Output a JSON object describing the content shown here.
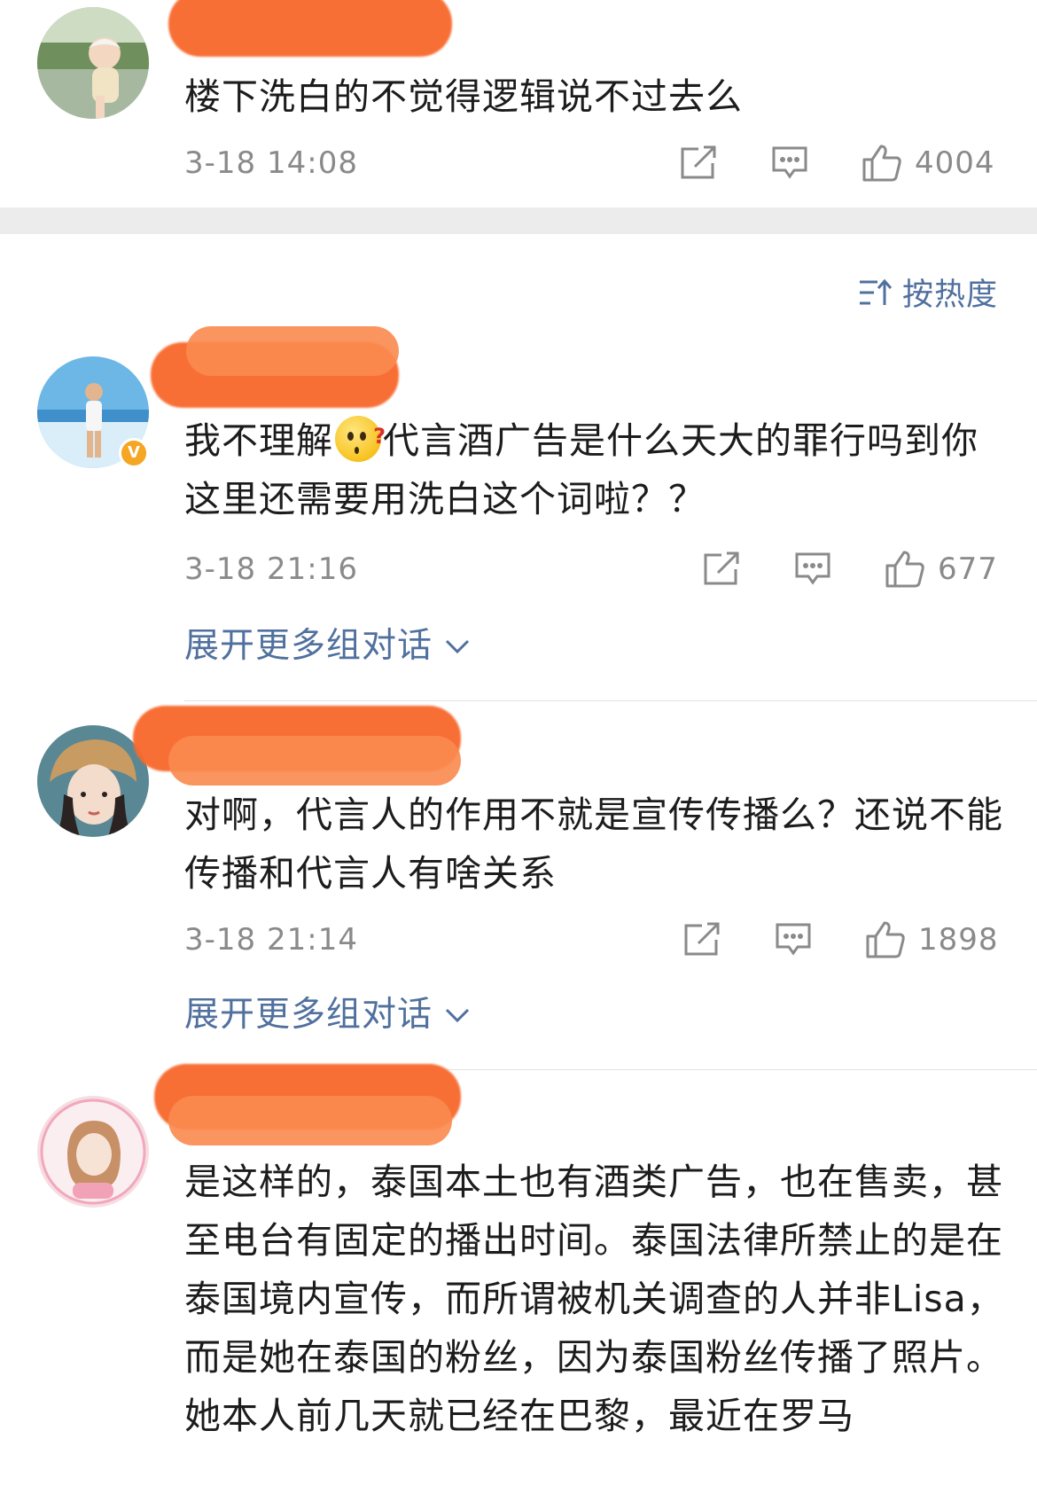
{
  "comments": [
    {
      "text": "楼下洗白的不觉得逻辑说不过去么",
      "time": "3-18 14:08",
      "likes": "4004"
    },
    {
      "text_before": "我不理解",
      "text_after": "代言酒广告是什么天大的罪行吗到你这里还需要用洗白这个词啦？？",
      "time": "3-18 21:16",
      "likes": "677",
      "expand": "展开更多组对话"
    },
    {
      "text": "对啊，代言人的作用不就是宣传传播么？还说不能传播和代言人有啥关系",
      "time": "3-18 21:14",
      "likes": "1898",
      "expand": "展开更多组对话"
    },
    {
      "text": "是这样的，泰国本土也有酒类广告，也在售卖，甚至电台有固定的播出时间。泰国法律所禁止的是在泰国境内宣传，而所谓被机关调查的人并非Lisa，而是她在泰国的粉丝，因为泰国粉丝传播了照片。她本人前几天就已经在巴黎，最近在罗马"
    }
  ],
  "sort": {
    "label": "按热度"
  },
  "icons": {
    "share": "share-icon",
    "comment": "comment-icon",
    "like": "thumbs-up-icon",
    "sort": "sort-icon",
    "expand": "chevron-down-icon",
    "verified": "verified-badge-icon"
  },
  "colors": {
    "link": "#50709e",
    "meta": "#8a8a8a",
    "redaction": "#f86a2e",
    "verified": "#f5a623"
  }
}
